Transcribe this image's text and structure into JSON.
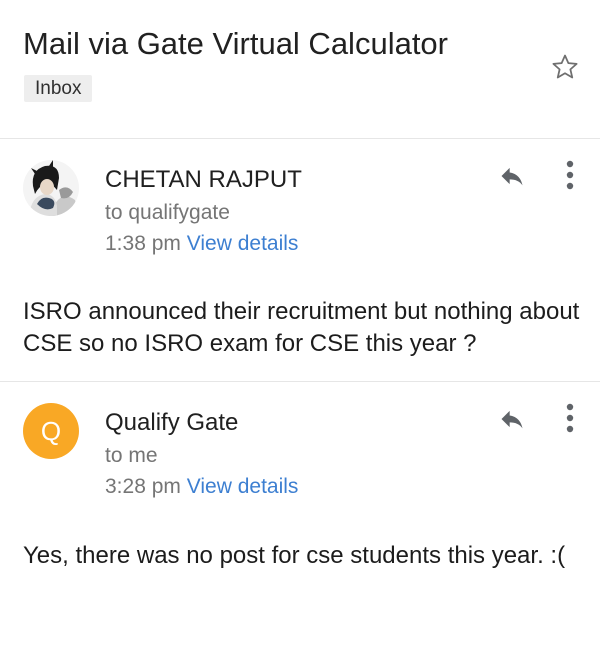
{
  "subject": "Mail via Gate Virtual Calculator",
  "label": "Inbox",
  "icons": {
    "star": "star-outline-icon",
    "reply": "reply-icon",
    "more": "more-vertical-icon"
  },
  "colors": {
    "link": "#3d7fd1",
    "avatar_qualify": "#f9a825"
  },
  "messages": [
    {
      "sender": "CHETAN RAJPUT",
      "recipient": "to qualifygate",
      "time": "1:38 pm",
      "details_link": "View details",
      "body": "ISRO announced their recruitment but nothing about CSE so no ISRO exam for CSE this year ?"
    },
    {
      "sender": "Qualify Gate",
      "avatar_letter": "Q",
      "recipient": "to me",
      "time": "3:28 pm",
      "details_link": "View details",
      "body": "Yes, there was no post for cse students this year. :("
    }
  ]
}
